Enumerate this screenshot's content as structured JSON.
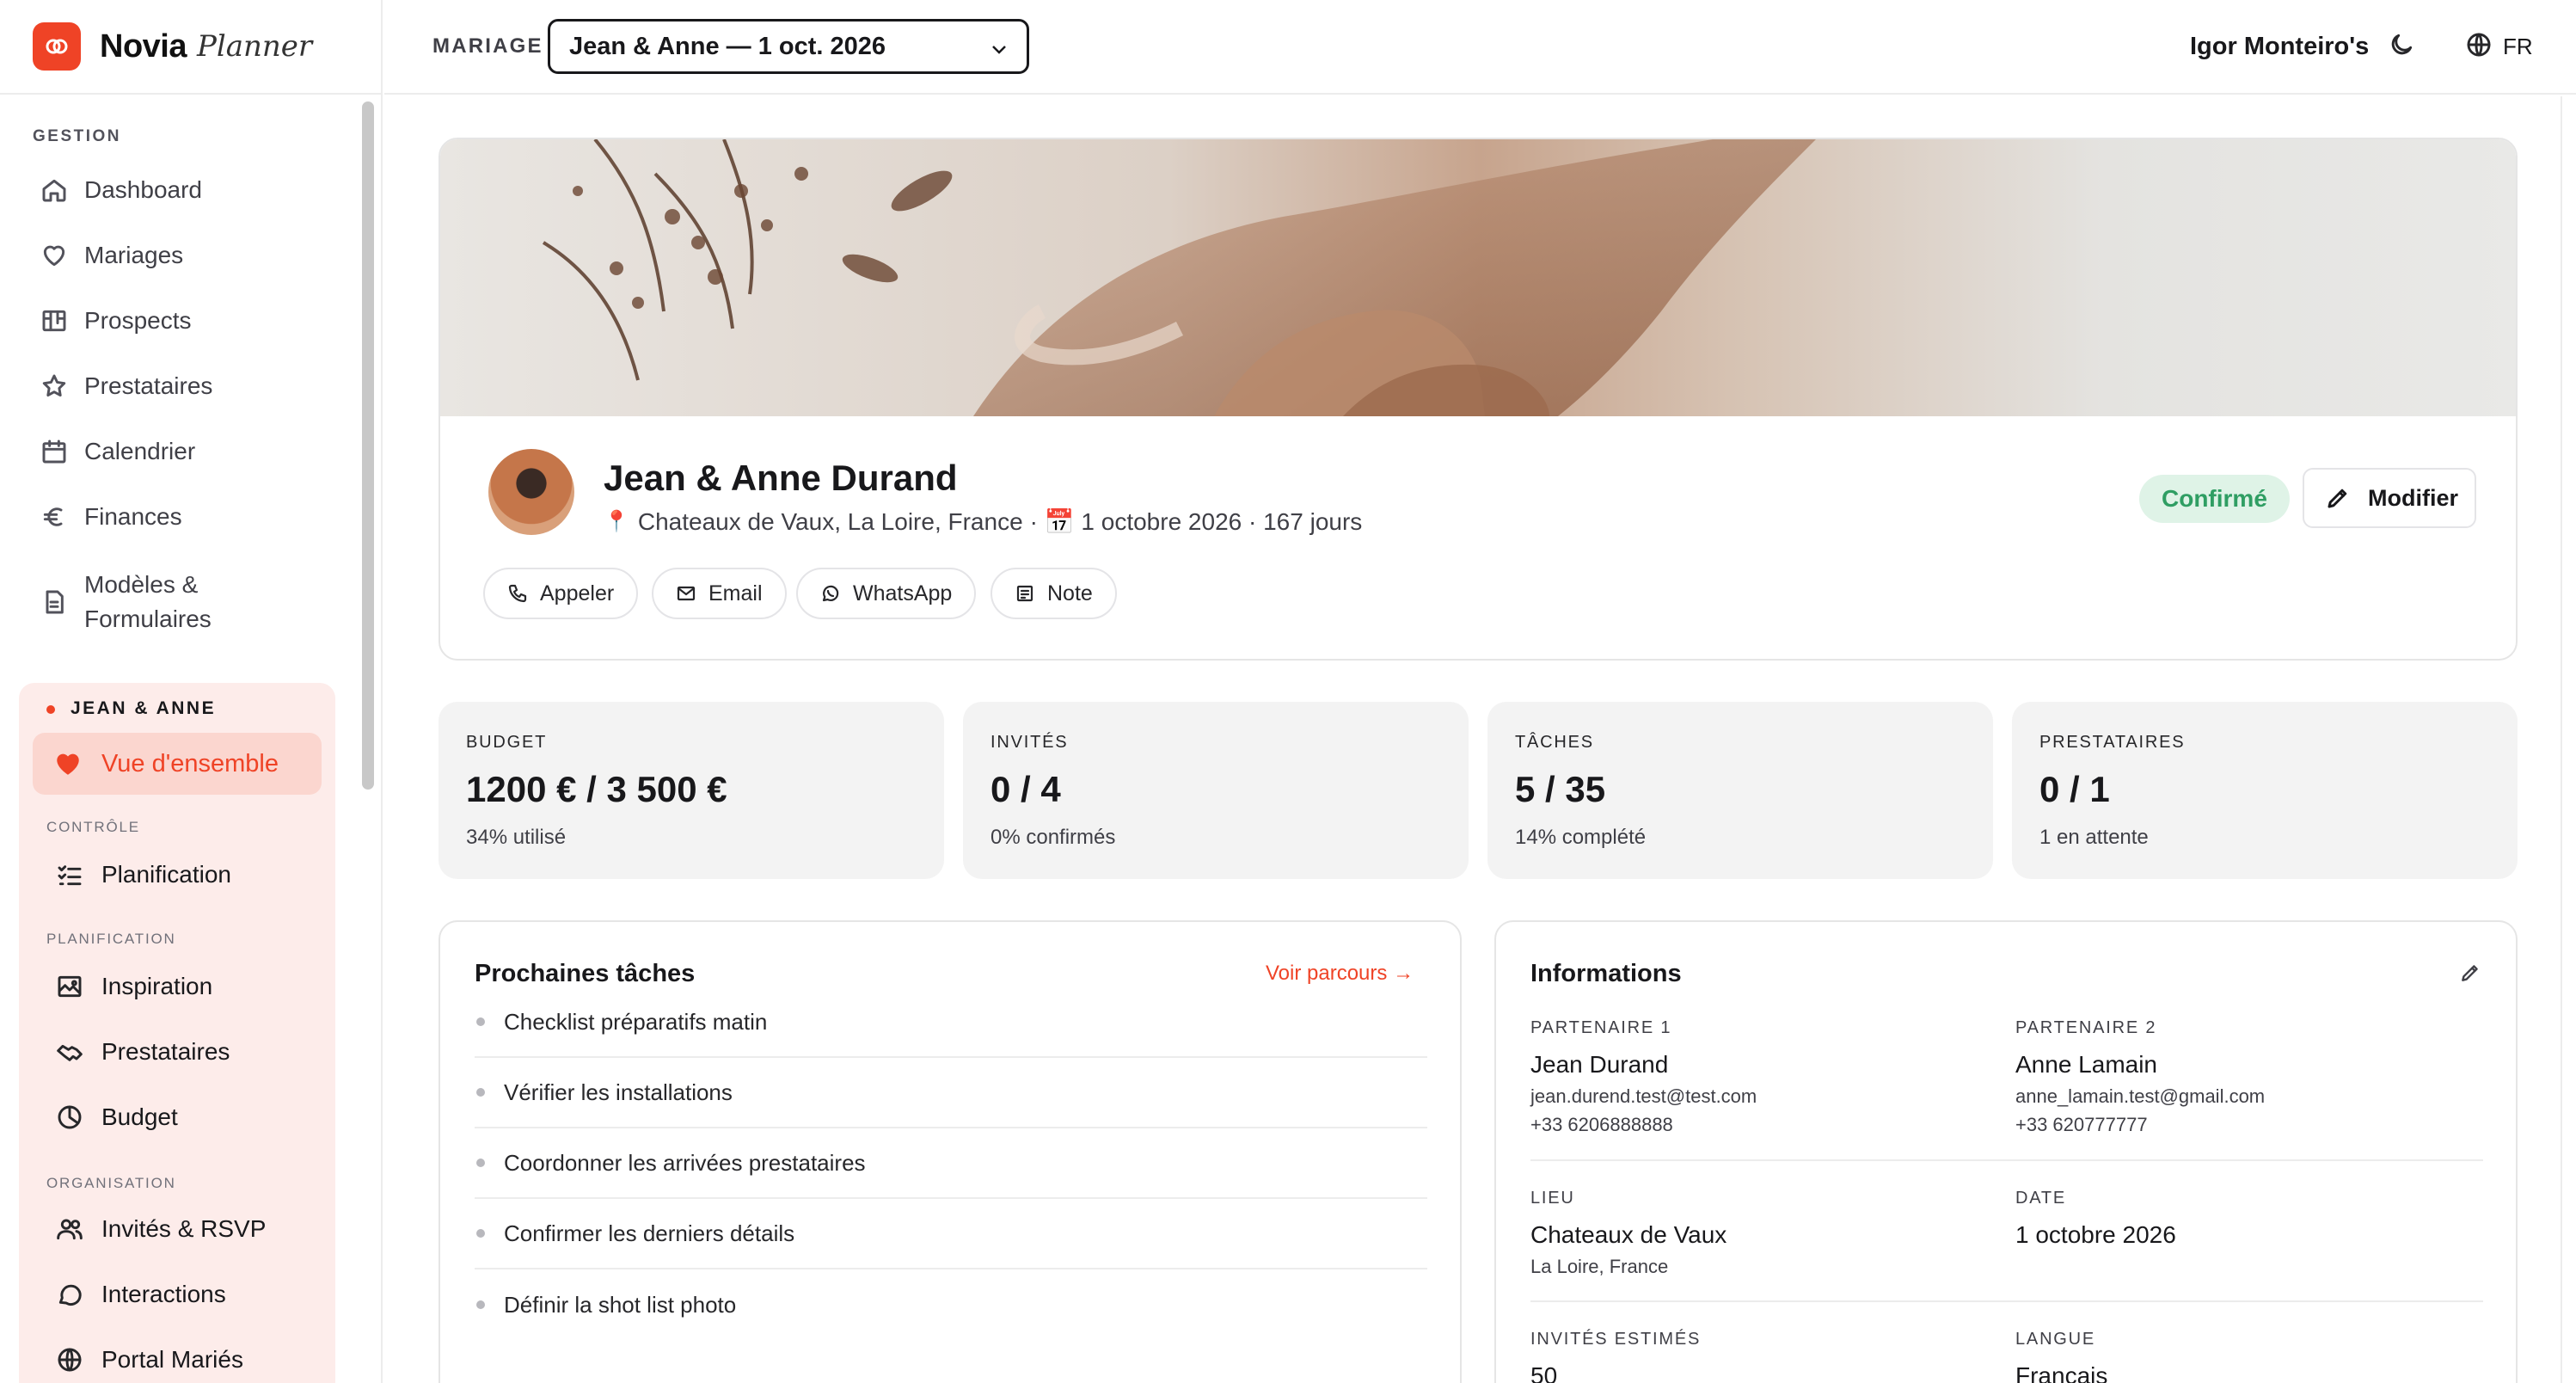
{
  "brand": {
    "name": "Novia",
    "sub": "Planner"
  },
  "sidebar": {
    "gestion_title": "GESTION",
    "items": [
      {
        "label": "Dashboard",
        "icon": "home-icon"
      },
      {
        "label": "Mariages",
        "icon": "heart-icon"
      },
      {
        "label": "Prospects",
        "icon": "kanban-icon"
      },
      {
        "label": "Prestataires",
        "icon": "star-icon"
      },
      {
        "label": "Calendrier",
        "icon": "calendar-icon"
      },
      {
        "label": "Finances",
        "icon": "euro-icon"
      },
      {
        "label": "Modèles & Formulaires",
        "label_line1": "Modèles &",
        "label_line2": "Formulaires",
        "icon": "file-icon"
      }
    ],
    "wedding": {
      "title": "JEAN & ANNE",
      "active": "Vue d'ensemble",
      "controle_title": "CONTRÔLE",
      "planification_title": "PLANIFICATION",
      "organisation_title": "ORGANISATION",
      "items": {
        "planification": "Planification",
        "inspiration": "Inspiration",
        "prestataires": "Prestataires",
        "budget": "Budget",
        "invites": "Invités & RSVP",
        "interactions": "Interactions",
        "portail": "Portal Mariés"
      }
    }
  },
  "header": {
    "label": "MARIAGE",
    "selected_wedding": "Jean & Anne — 1 oct. 2026",
    "user": "Igor Monteiro's",
    "lang": "FR"
  },
  "hero": {
    "name": "Jean & Anne Durand",
    "location": "Chateaux de Vaux, La Loire, France",
    "meta": "· 📅 1 octobre 2026 · 167 jours",
    "status": "Confirmé",
    "edit_label": "Modifier",
    "actions": [
      "Appeler",
      "Email",
      "WhatsApp",
      "Note"
    ]
  },
  "stats": [
    {
      "label": "BUDGET",
      "value": "1200 € / 3 500 €",
      "sub": "34% utilisé"
    },
    {
      "label": "INVITÉS",
      "value": "0 / 4",
      "sub": "0% confirmés"
    },
    {
      "label": "TÂCHES",
      "value": "5 / 35",
      "sub": "14% complété"
    },
    {
      "label": "PRESTATAIRES",
      "value": "0 / 1",
      "sub": "1 en attente"
    }
  ],
  "tasks": {
    "title": "Prochaines tâches",
    "link": "Voir parcours →",
    "items": [
      "Checklist préparatifs matin",
      "Vérifier les installations",
      "Coordonner les arrivées prestataires",
      "Confirmer les derniers détails",
      "Définir la shot list photo"
    ]
  },
  "info": {
    "title": "Informations",
    "partner1": {
      "label": "PARTENAIRE 1",
      "name": "Jean Durand",
      "email": "jean.durend.test@test.com",
      "phone": "+33 6206888888"
    },
    "partner2": {
      "label": "PARTENAIRE 2",
      "name": "Anne Lamain",
      "email": "anne_lamain.test@gmail.com",
      "phone": "+33 620777777"
    },
    "lieu": {
      "label": "LIEU",
      "value": "Chateaux de Vaux",
      "sub": "La Loire, France"
    },
    "date": {
      "label": "DATE",
      "value": "1 octobre 2026"
    },
    "invites": {
      "label": "INVITÉS ESTIMÉS",
      "value": "50"
    },
    "langue": {
      "label": "LANGUE",
      "value": "Français"
    }
  },
  "colors": {
    "accent": "#ef4326",
    "status_bg": "#dff3e7",
    "status_text": "#2f9e63",
    "panel_bg": "#fdecea"
  }
}
